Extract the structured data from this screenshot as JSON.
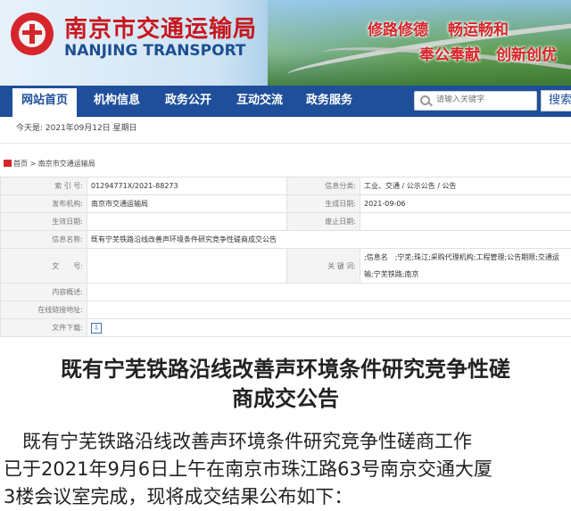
{
  "header": {
    "org_cn": "南京市交通运输局",
    "org_en": "NANJING TRANSPORT",
    "slogans": [
      "修路修德",
      "畅运畅和",
      "奉公奉献",
      "创新创优"
    ],
    "colors": {
      "brand_red": "#d7262b",
      "nav_blue": "#1f4f9b"
    }
  },
  "nav": {
    "items": [
      "网站首页",
      "机构信息",
      "政务公开",
      "互动交流",
      "政务服务"
    ],
    "active_index": 0,
    "search_placeholder": "请输入关键字",
    "search_button": "搜索"
  },
  "date_line": "今天是: 2021年09月12日 星期日",
  "breadcrumb": {
    "home": "首页",
    "sep": ">",
    "current": "南京市交通运输局"
  },
  "info_table": {
    "index_no_label": "索 引 号:",
    "index_no": "01294771X/2021-88273",
    "category_label": "信息分类:",
    "category": "工业、交通 / 公示公告 / 公告",
    "issuer_label": "发布机构:",
    "issuer": "南京市交通运输局",
    "created_label": "生成日期:",
    "created": "2021-09-06",
    "effective_label": "生效日期:",
    "effective": "",
    "expiry_label": "废止日期:",
    "expiry": "",
    "name_label": "信息名称:",
    "name": "既有宁芜铁路沿线改善声环境条件研究竞争性磋商成交公告",
    "doc_no_label": "文　　号:",
    "doc_no": "",
    "keywords_label": "关 键 词:",
    "keywords_line1": ";信息名　;宁芜;珠江;采购代理机构;工程管理;公告期限;交通运",
    "keywords_line2": "输;宁芜铁路;南京",
    "summary_label": "内容概述:",
    "summary": "",
    "link_label": "在线链接地址:",
    "link": "",
    "download_label": "文件下载:",
    "download_icon": "download-icon"
  },
  "article": {
    "title_line1": "既有宁芜铁路沿线改善声环境条件研究竞争性磋",
    "title_line2": "商成交公告",
    "para_line1": "　既有宁芜铁路沿线改善声环境条件研究竞争性磋商工作",
    "para_line2": "已于2021年9月6日上午在南京市珠江路63号南京交通大厦",
    "para_line3": "3楼会议室完成，现将成交结果公布如下："
  }
}
